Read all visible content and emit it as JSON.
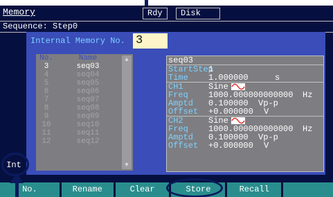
{
  "header": {
    "menu_title": "Memory",
    "status_rdy": "Rdy",
    "status_disk": "Disk",
    "sequence_line": "Sequence: Step0"
  },
  "memory": {
    "label": "Internal Memory No.",
    "value": "3"
  },
  "table": {
    "col_no": "No.",
    "col_name": "Name",
    "rows": [
      {
        "no": "3",
        "name": "seq03"
      },
      {
        "no": "4",
        "name": "seq04"
      },
      {
        "no": "5",
        "name": "seq05"
      },
      {
        "no": "6",
        "name": "seq06"
      },
      {
        "no": "7",
        "name": "seq07"
      },
      {
        "no": "8",
        "name": "seq08"
      },
      {
        "no": "9",
        "name": "seq09"
      },
      {
        "no": "10",
        "name": "seq10"
      },
      {
        "no": "11",
        "name": "seq11"
      },
      {
        "no": "12",
        "name": "seq12"
      }
    ]
  },
  "detail": {
    "name": "seq03",
    "start_step_key": "StartStep",
    "start_step_val": "1",
    "time_key": "Time",
    "time_val": "1.000000",
    "time_unit": "s",
    "ch1_key": "CH1",
    "ch1_wave": "Sine",
    "freq1_key": "Freq",
    "freq1_val": "1000.000000000000",
    "freq1_unit": "Hz",
    "amp1_key": "Amptd",
    "amp1_val": "0.100000",
    "amp1_unit": "Vp-p",
    "off1_key": "Offset",
    "off1_val": "+0.000000",
    "off1_unit": "V",
    "ch2_key": "CH2",
    "ch2_wave": "Sine",
    "freq2_key": "Freq",
    "freq2_val": "1000.000000000000",
    "freq2_unit": "Hz",
    "amp2_key": "Amptd",
    "amp2_val": "0.100000",
    "amp2_unit": "Vp-p",
    "off2_key": "Offset",
    "off2_val": "+0.000000",
    "off2_unit": "V"
  },
  "side": {
    "int_label": "Int"
  },
  "softkeys": [
    "No.",
    "Rename",
    "Clear",
    "Store",
    "Recall",
    ""
  ],
  "colors": {
    "screen_bg": "#061040",
    "panel_bg": "#3a4db8",
    "softkey_bg": "#2a8d8d",
    "label_cyan": "#7fd0ff",
    "sine_red": "#e03030"
  }
}
